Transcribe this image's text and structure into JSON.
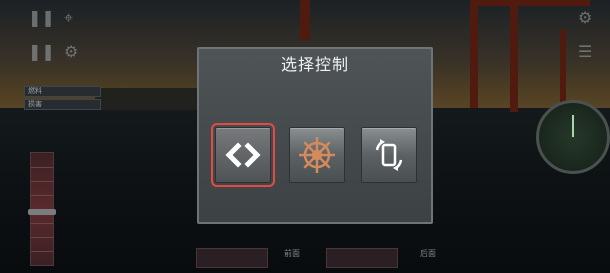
{
  "dialog": {
    "title": "选择控制",
    "options": [
      {
        "icon": "arrows-left-right-icon",
        "selected": true
      },
      {
        "icon": "ship-wheel-icon",
        "selected": false
      },
      {
        "icon": "tilt-rotate-icon",
        "selected": false
      }
    ]
  },
  "hud": {
    "fuel_label": "燃料",
    "damage_label": "损害",
    "left_gauge_label": "前面",
    "right_gauge_label": "后面"
  },
  "colors": {
    "selection_outline": "#e24b43",
    "wheel": "#d58a5b"
  }
}
